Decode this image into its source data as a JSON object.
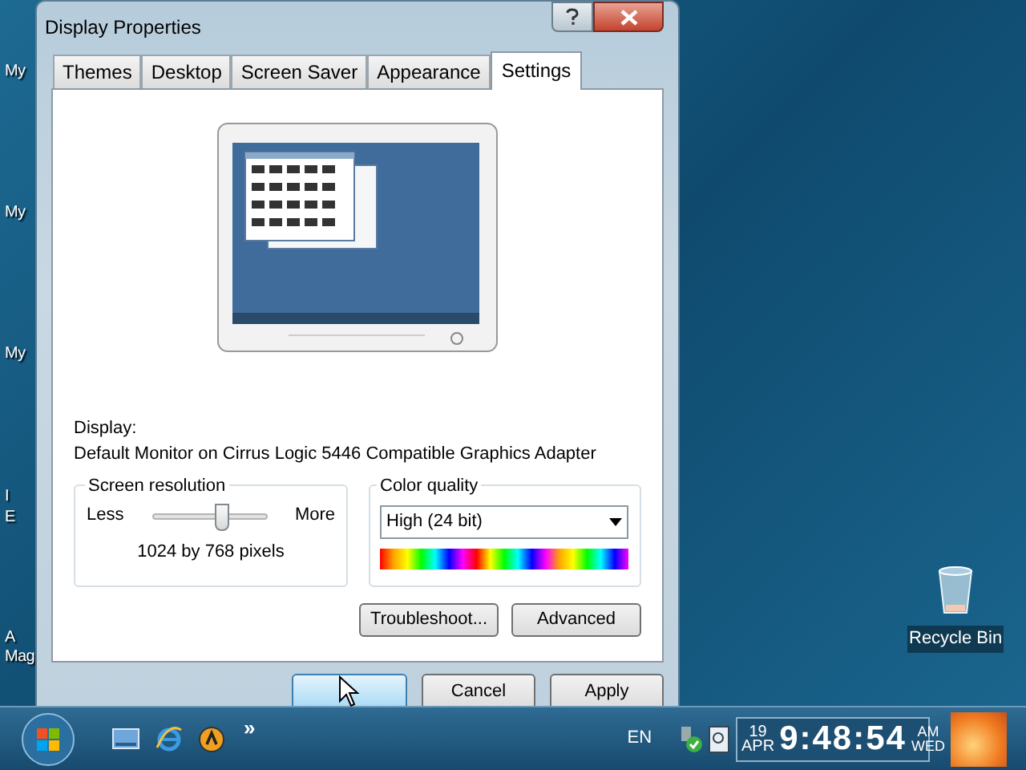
{
  "desktop": {
    "icon_labels": [
      {
        "text": "My"
      },
      {
        "text": "My"
      },
      {
        "text": "My"
      },
      {
        "text": "I"
      },
      {
        "text": "E"
      },
      {
        "text": "A"
      },
      {
        "text": "Mag"
      }
    ],
    "recycle_bin": "Recycle Bin"
  },
  "window": {
    "title": "Display Properties"
  },
  "tabs": [
    {
      "label": "Themes",
      "selected": false
    },
    {
      "label": "Desktop",
      "selected": false
    },
    {
      "label": "Screen Saver",
      "selected": false
    },
    {
      "label": "Appearance",
      "selected": false
    },
    {
      "label": "Settings",
      "selected": true
    }
  ],
  "display": {
    "label": "Display:",
    "value": "Default Monitor on Cirrus Logic 5446 Compatible Graphics Adapter"
  },
  "resolution": {
    "title": "Screen resolution",
    "min_label": "Less",
    "max_label": "More",
    "level": 0.62,
    "reading": "1024 by 768 pixels"
  },
  "color_quality": {
    "title": "Color quality",
    "value": "High (24 bit)"
  },
  "panel_buttons": [
    {
      "label": "Troubleshoot..."
    },
    {
      "label": "Advanced"
    }
  ],
  "dialog_buttons": [
    {
      "label": "Cancel"
    },
    {
      "label": "Apply"
    }
  ],
  "taskbar": {
    "overflow": "»",
    "language": "EN",
    "clock": {
      "day": "19",
      "month": "APR",
      "time": "9:48:54",
      "ampm": "AM",
      "weekday": "WED"
    }
  }
}
